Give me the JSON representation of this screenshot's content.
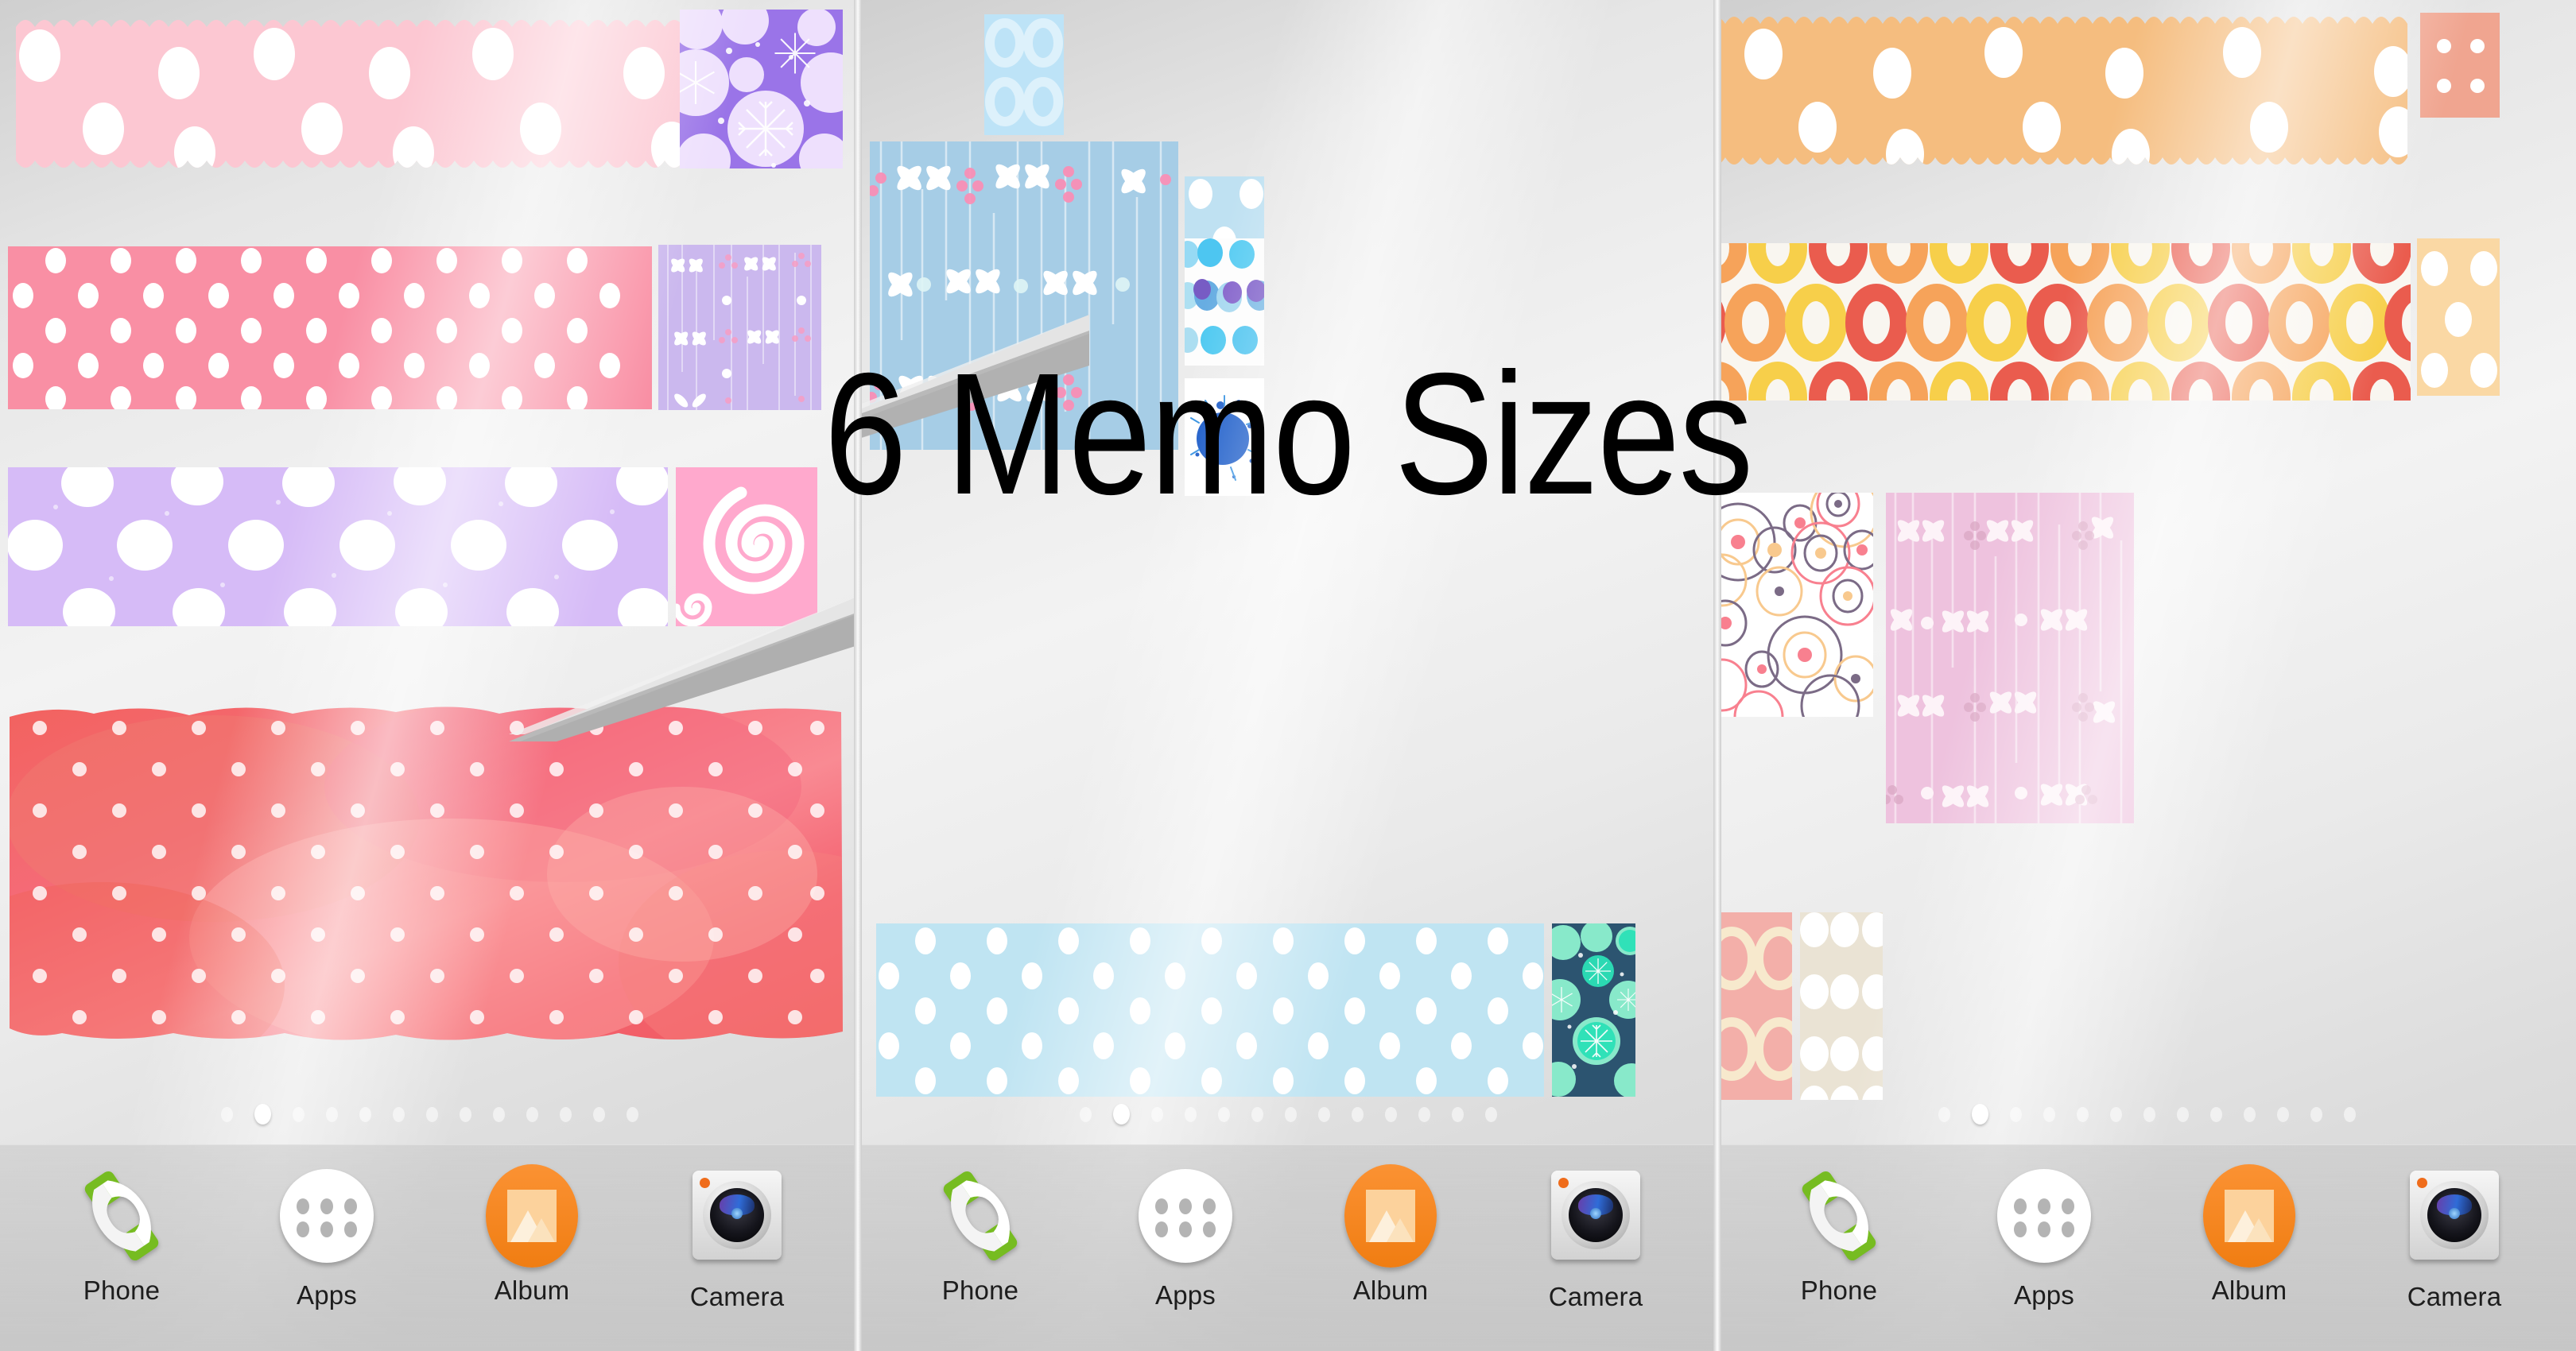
{
  "title": "6 Memo Sizes",
  "theme": {
    "accent": "#f58220",
    "dock_bg": "#c4c4c4",
    "wallpaper": "#e8e8e8"
  },
  "page_indicator": {
    "total": 13,
    "active_index": 1
  },
  "dock": {
    "items": [
      {
        "label": "Phone",
        "icon": "phone-handset-icon"
      },
      {
        "label": "Apps",
        "icon": "apps-grid-icon"
      },
      {
        "label": "Album",
        "icon": "album-photo-icon"
      },
      {
        "label": "Camera",
        "icon": "camera-lens-icon"
      }
    ]
  },
  "panels": [
    {
      "name": "pink-memo-home-screen",
      "widgets": [
        {
          "name": "memo-wide-scalloped-pink",
          "size": "4x2",
          "pattern": "scalloped-polka",
          "color": "#fcc7d2"
        },
        {
          "name": "memo-tall-snowflake-purple",
          "size": "1x2",
          "pattern": "snowflake-mandala",
          "color": "#9a74e8"
        },
        {
          "name": "memo-wide-polka-rose",
          "size": "4x2",
          "pattern": "polka-dot",
          "color": "#f98fa4"
        },
        {
          "name": "memo-tall-stripe-lilac",
          "size": "1x2",
          "pattern": "vertical-stripe-floral",
          "color": "#cbb8ee"
        },
        {
          "name": "memo-wide-fluffy-lavender",
          "size": "4x2",
          "pattern": "fluffy-dot",
          "color": "#d6bbf7"
        },
        {
          "name": "memo-small-swirl-pink",
          "size": "1x1",
          "pattern": "spiral-swirl",
          "color": "#ffa9cd"
        },
        {
          "name": "memo-wide-watercolor-coral",
          "size": "4x3",
          "pattern": "watercolor-polka",
          "color": "#f5657a"
        }
      ]
    },
    {
      "name": "blue-memo-home-screen",
      "widgets": [
        {
          "name": "memo-small-rings-skyblue",
          "size": "1x1",
          "pattern": "four-rings",
          "color": "#bde3f7"
        },
        {
          "name": "memo-large-floral-blue",
          "size": "4x4",
          "pattern": "vertical-stripe-floral",
          "color": "#a6cde6"
        },
        {
          "name": "memo-small-polka-lightblue",
          "size": "1x1",
          "pattern": "polka-dot",
          "color": "#bfe1f2"
        },
        {
          "name": "memo-small-watercolor-dots",
          "size": "1x1",
          "pattern": "watercolor-dots",
          "color": "#3aa8e8"
        },
        {
          "name": "memo-small-ink-splatter",
          "size": "1x1",
          "pattern": "ink-splatter",
          "color": "#1558c4"
        },
        {
          "name": "memo-wide-polka-paleblue",
          "size": "4x2",
          "pattern": "polka-dot",
          "color": "#bfe4f2"
        },
        {
          "name": "memo-small-snowflake-teal",
          "size": "1x1",
          "pattern": "snowflake-mandala",
          "color": "#2c5470"
        }
      ]
    },
    {
      "name": "orange-memo-home-screen",
      "widgets": [
        {
          "name": "memo-wide-scalloped-apricot",
          "size": "4x2",
          "pattern": "scalloped-polka",
          "color": "#f5bd7f"
        },
        {
          "name": "memo-small-polka-salmon",
          "size": "1x1",
          "pattern": "polka-dot-sparse",
          "color": "#f0a590"
        },
        {
          "name": "memo-wide-donut-rings",
          "size": "4x2",
          "pattern": "donut-rings",
          "color": "#f6f4ef"
        },
        {
          "name": "memo-small-polka-peach",
          "size": "1x1",
          "pattern": "polka-dot-five",
          "color": "#fad8a4"
        },
        {
          "name": "memo-medium-circles-white",
          "size": "2x2",
          "pattern": "outline-circles",
          "color": "#ffffff"
        },
        {
          "name": "memo-large-floral-pink",
          "size": "3x4",
          "pattern": "vertical-stripe-floral",
          "color": "#eec2de"
        },
        {
          "name": "memo-small-rings-blush",
          "size": "1x1",
          "pattern": "four-rings",
          "color": "#f3afa9"
        },
        {
          "name": "memo-small-polka-cream",
          "size": "1x1",
          "pattern": "polka-dot",
          "color": "#eae3d4"
        }
      ]
    }
  ]
}
